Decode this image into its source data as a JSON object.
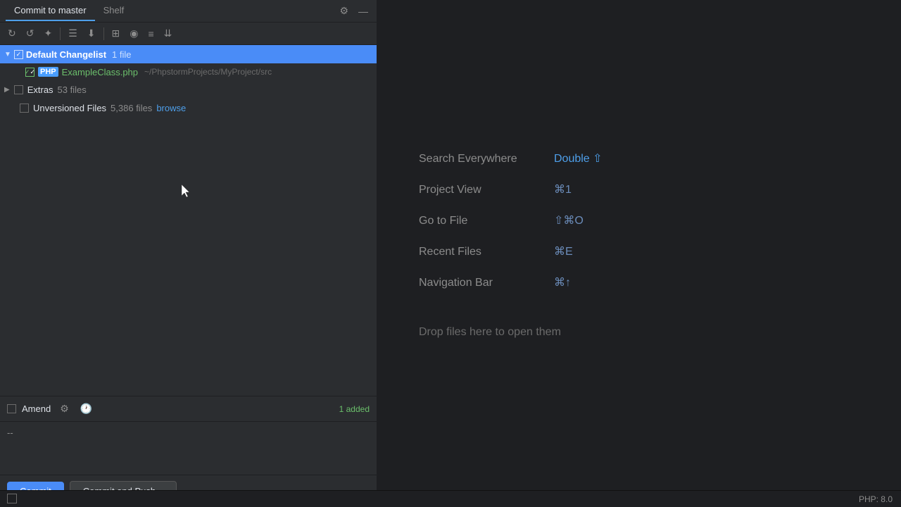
{
  "tabs": {
    "commit_label": "Commit to master",
    "shelf_label": "Shelf"
  },
  "toolbar": {
    "icons": [
      "↻",
      "↺",
      "⊕",
      "☰",
      "⬇",
      "⣿",
      "◉",
      "≡",
      "⇊"
    ]
  },
  "changelist": {
    "label": "Default Changelist",
    "count": "1 file",
    "file": {
      "name": "ExampleClass.php",
      "path": "~/PhpstormProjects/MyProject/src"
    }
  },
  "extras": {
    "label": "Extras",
    "count": "53 files"
  },
  "unversioned": {
    "label": "Unversioned Files",
    "count": "5,386 files",
    "browse": "browse"
  },
  "amend": {
    "label": "Amend",
    "badge": "1 added"
  },
  "commit_message": {
    "placeholder": "--"
  },
  "buttons": {
    "commit": "Commit",
    "commit_push": "Commit and Push..."
  },
  "shortcuts": [
    {
      "label": "Search Everywhere",
      "keys": "Double ⇧",
      "colored": true
    },
    {
      "label": "Project View",
      "keys": "⌘1",
      "colored": false
    },
    {
      "label": "Go to File",
      "keys": "⇧⌘O",
      "colored": false
    },
    {
      "label": "Recent Files",
      "keys": "⌘E",
      "colored": false
    },
    {
      "label": "Navigation Bar",
      "keys": "⌘↑",
      "colored": false
    }
  ],
  "drop_text": "Drop files here to open them",
  "status": {
    "php_version": "PHP: 8.0"
  }
}
